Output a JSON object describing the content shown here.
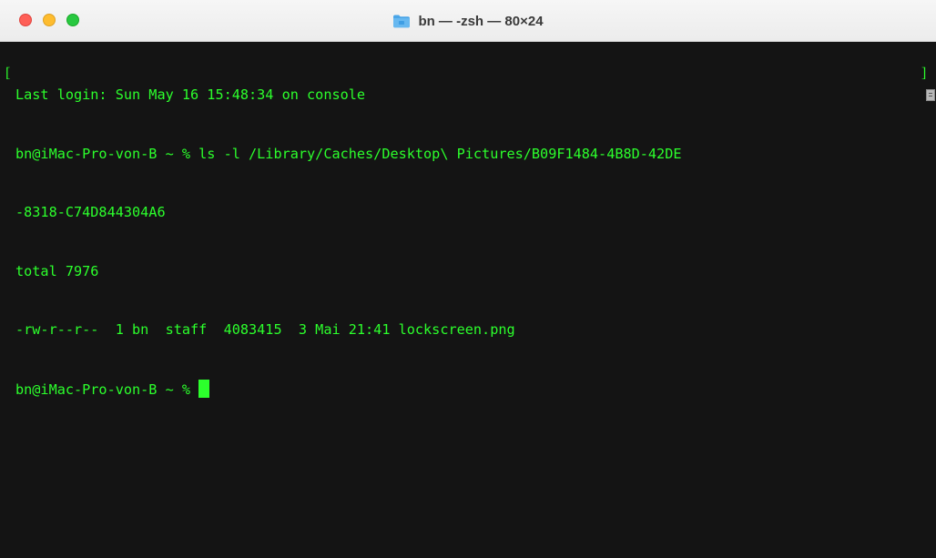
{
  "window": {
    "title": "bn — -zsh — 80×24",
    "folder_icon": "folder-icon"
  },
  "terminal": {
    "lines": [
      "Last login: Sun May 16 15:48:34 on console",
      "bn@iMac-Pro-von-B ~ % ls -l /Library/Caches/Desktop\\ Pictures/B09F1484-4B8D-42DE",
      "-8318-C74D844304A6",
      "total 7976",
      "-rw-r--r--  1 bn  staff  4083415  3 Mai 21:41 lockscreen.png",
      "bn@iMac-Pro-von-B ~ % "
    ],
    "text_color": "#2cff2c",
    "background_color": "#141414"
  },
  "colors": {
    "close": "#fe5f57",
    "minimize": "#febc2e",
    "zoom": "#28c840"
  }
}
